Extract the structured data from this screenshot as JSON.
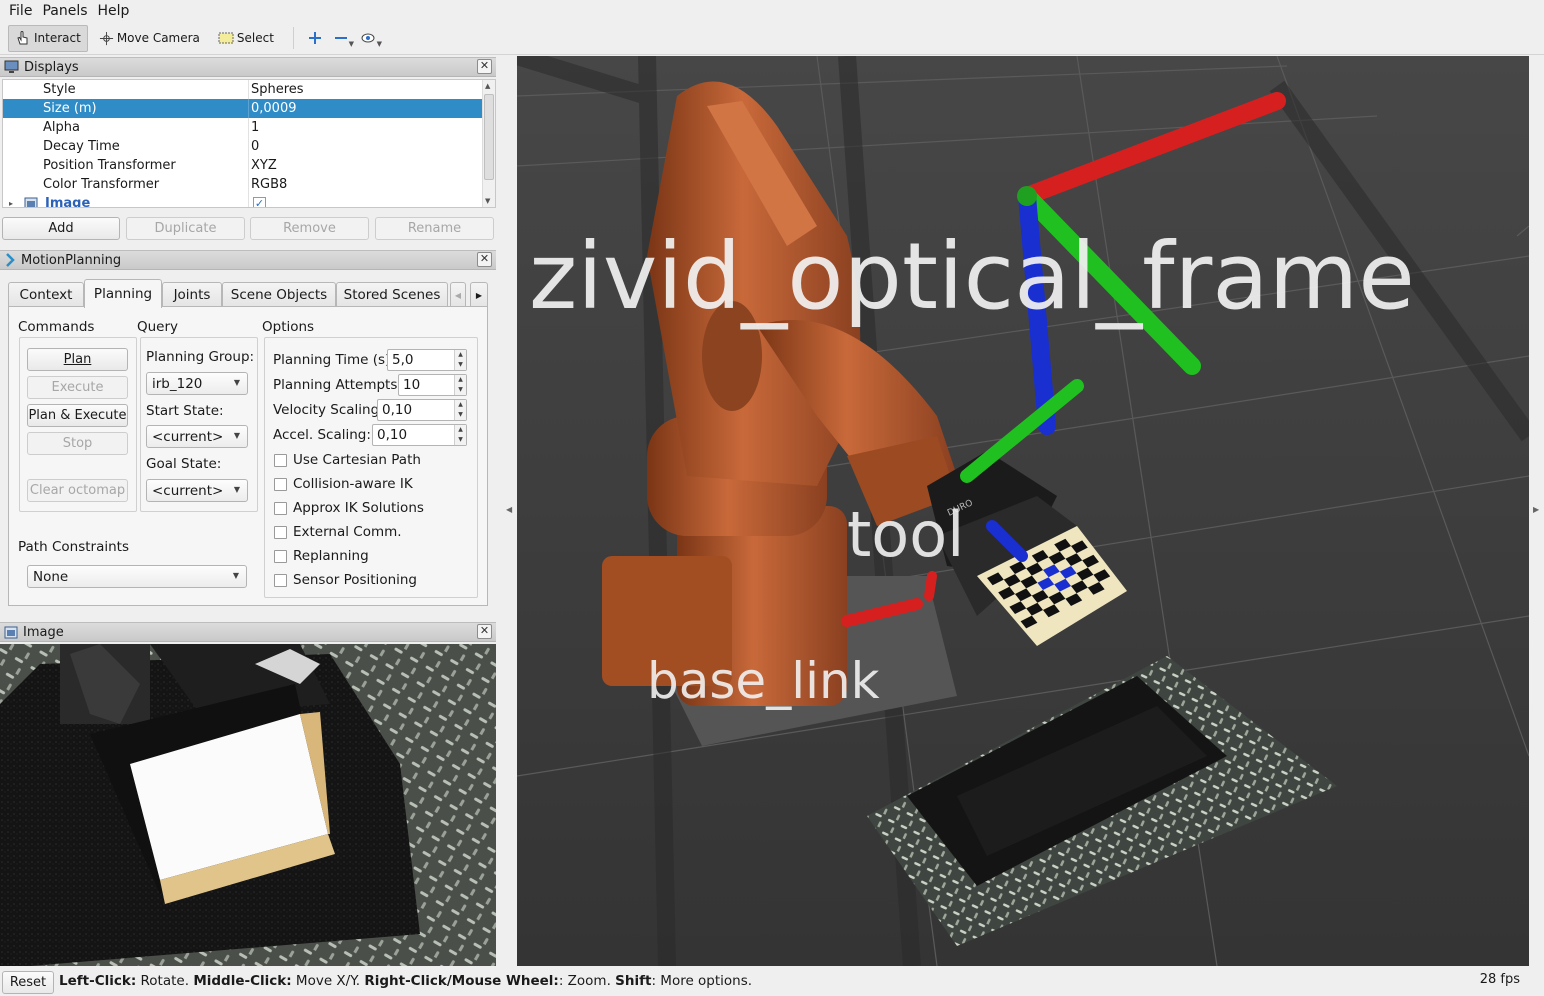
{
  "menu": {
    "file": "File",
    "panels": "Panels",
    "help": "Help"
  },
  "toolbar": {
    "interact": "Interact",
    "move_camera": "Move Camera",
    "select": "Select"
  },
  "displays": {
    "title": "Displays",
    "rows": [
      {
        "key": "Style",
        "value": "Spheres"
      },
      {
        "key": "Size (m)",
        "value": "0,0009"
      },
      {
        "key": "Alpha",
        "value": "1"
      },
      {
        "key": "Decay Time",
        "value": "0"
      },
      {
        "key": "Position Transformer",
        "value": "XYZ"
      },
      {
        "key": "Color Transformer",
        "value": "RGB8"
      }
    ],
    "image_item": "Image",
    "buttons": {
      "add": "Add",
      "duplicate": "Duplicate",
      "remove": "Remove",
      "rename": "Rename"
    }
  },
  "motion": {
    "title": "MotionPlanning",
    "tabs": [
      "Context",
      "Planning",
      "Joints",
      "Scene Objects",
      "Stored Scenes"
    ],
    "commands": {
      "label": "Commands",
      "plan": "Plan",
      "execute": "Execute",
      "plan_execute": "Plan & Execute",
      "stop": "Stop",
      "clear_octomap": "Clear octomap"
    },
    "query": {
      "label": "Query",
      "planning_group_label": "Planning Group:",
      "planning_group": "irb_120",
      "start_state_label": "Start State:",
      "start_state": "<current>",
      "goal_state_label": "Goal State:",
      "goal_state": "<current>"
    },
    "options": {
      "label": "Options",
      "planning_time_label": "Planning Time (s):",
      "planning_time": "5,0",
      "planning_attempts_label": "Planning Attempts:",
      "planning_attempts": "10",
      "velocity_scaling_label": "Velocity Scaling:",
      "velocity_scaling": "0,10",
      "accel_scaling_label": "Accel. Scaling:",
      "accel_scaling": "0,10",
      "checks": [
        "Use Cartesian Path",
        "Collision-aware IK",
        "Approx IK Solutions",
        "External Comm.",
        "Replanning",
        "Sensor Positioning"
      ]
    },
    "path_constraints": {
      "label": "Path Constraints",
      "value": "None"
    }
  },
  "image_panel": {
    "title": "Image"
  },
  "scene": {
    "frame_label": "zivid_optical_frame",
    "tool_label": "tool",
    "base_label": "base_link",
    "gripper_text": "DURO"
  },
  "status": {
    "reset": "Reset",
    "left_click": "Left-Click:",
    "left_desc": " Rotate. ",
    "middle_click": "Middle-Click:",
    "middle_desc": " Move X/Y. ",
    "right_click": "Right-Click/Mouse Wheel:",
    "right_desc": ": Zoom. ",
    "shift": "Shift",
    "shift_desc": ": More options.",
    "fps": "28 fps"
  },
  "colors": {
    "selection": "#308cc6",
    "robot": "#b35a2b",
    "axis_x": "#d62020",
    "axis_y": "#20c020",
    "axis_z": "#1a2fd0"
  }
}
